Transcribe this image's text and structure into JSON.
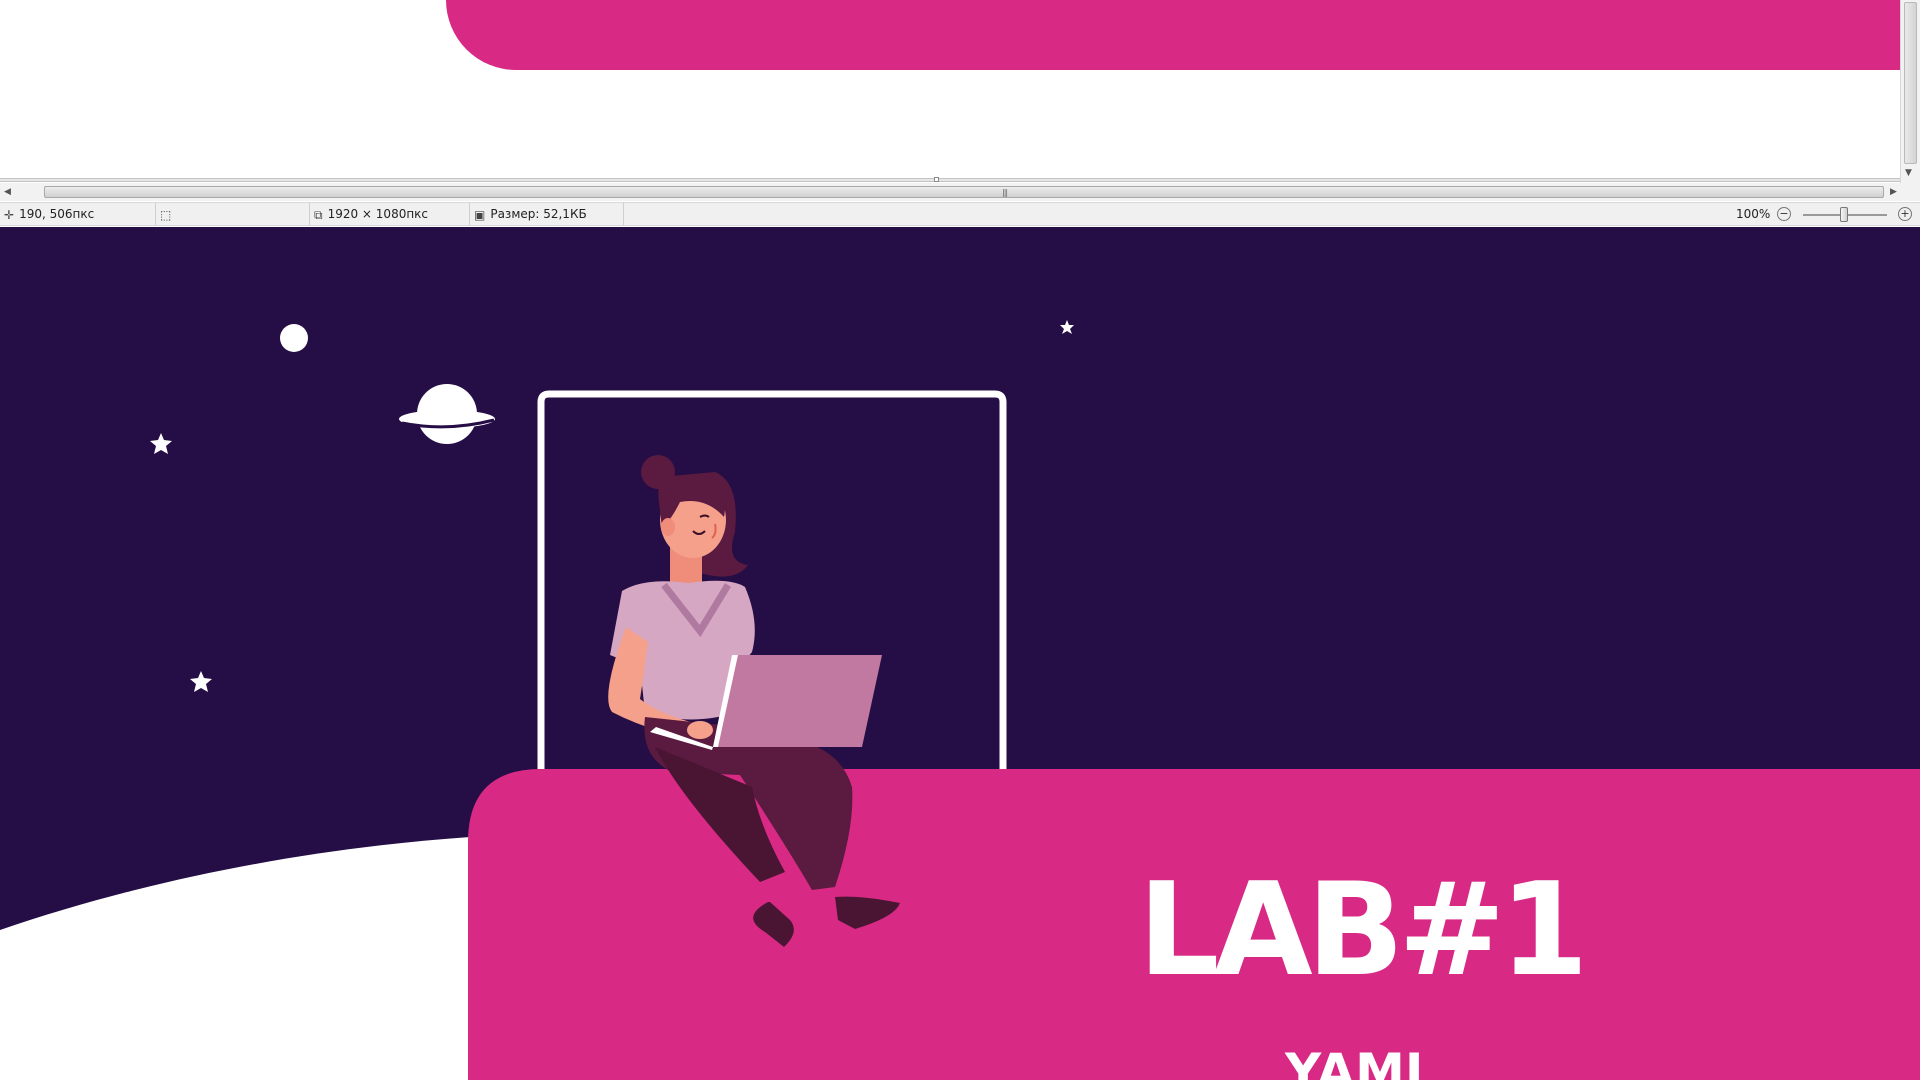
{
  "colors": {
    "background": "#250d45",
    "accent_pink": "#d82a85",
    "window_frame": "#ffffff"
  },
  "statusbar": {
    "cursor_position": "190, 506пкс",
    "image_dimensions": "1920 × 1080пкс",
    "file_size": "Размер: 52,1КБ",
    "zoom": "100%",
    "icons": {
      "cursor": "crosshair-icon",
      "selection": "selection-icon",
      "dimensions": "image-size-icon",
      "file_size": "disk-icon",
      "zoom_out": "zoom-out-icon",
      "zoom_in": "zoom-in-icon"
    }
  },
  "slide": {
    "title": "LAB#1",
    "subtitle": "YAML"
  }
}
